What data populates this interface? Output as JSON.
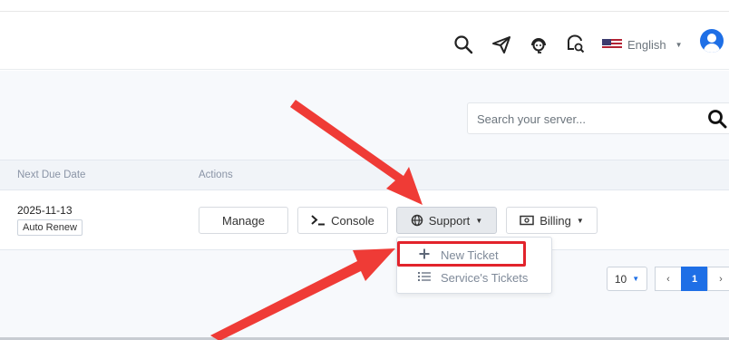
{
  "header": {
    "icons": [
      "search-icon",
      "send-icon",
      "support-agent-icon",
      "ticket-search-icon"
    ],
    "language": {
      "label": "English",
      "flag": "us-flag"
    },
    "avatar_icon": "user-avatar-icon"
  },
  "search": {
    "placeholder": "Search your server...",
    "value": ""
  },
  "table": {
    "columns": [
      "Next Due Date",
      "Actions"
    ],
    "row": {
      "due_date": "2025-11-13",
      "badge": "Auto Renew",
      "actions": {
        "manage": "Manage",
        "console": "Console",
        "support": "Support",
        "billing": "Billing"
      }
    }
  },
  "support_menu": {
    "items": [
      {
        "label": "New Ticket",
        "icon": "plus-icon"
      },
      {
        "label": "Service's Tickets",
        "icon": "list-icon"
      }
    ]
  },
  "pagination": {
    "per_page": "10",
    "prev": "‹",
    "current_page": "1",
    "next": "›"
  },
  "colors": {
    "accent": "#1e6fe6",
    "annotation": "#ef3b36",
    "highlight": "#e2232c"
  }
}
